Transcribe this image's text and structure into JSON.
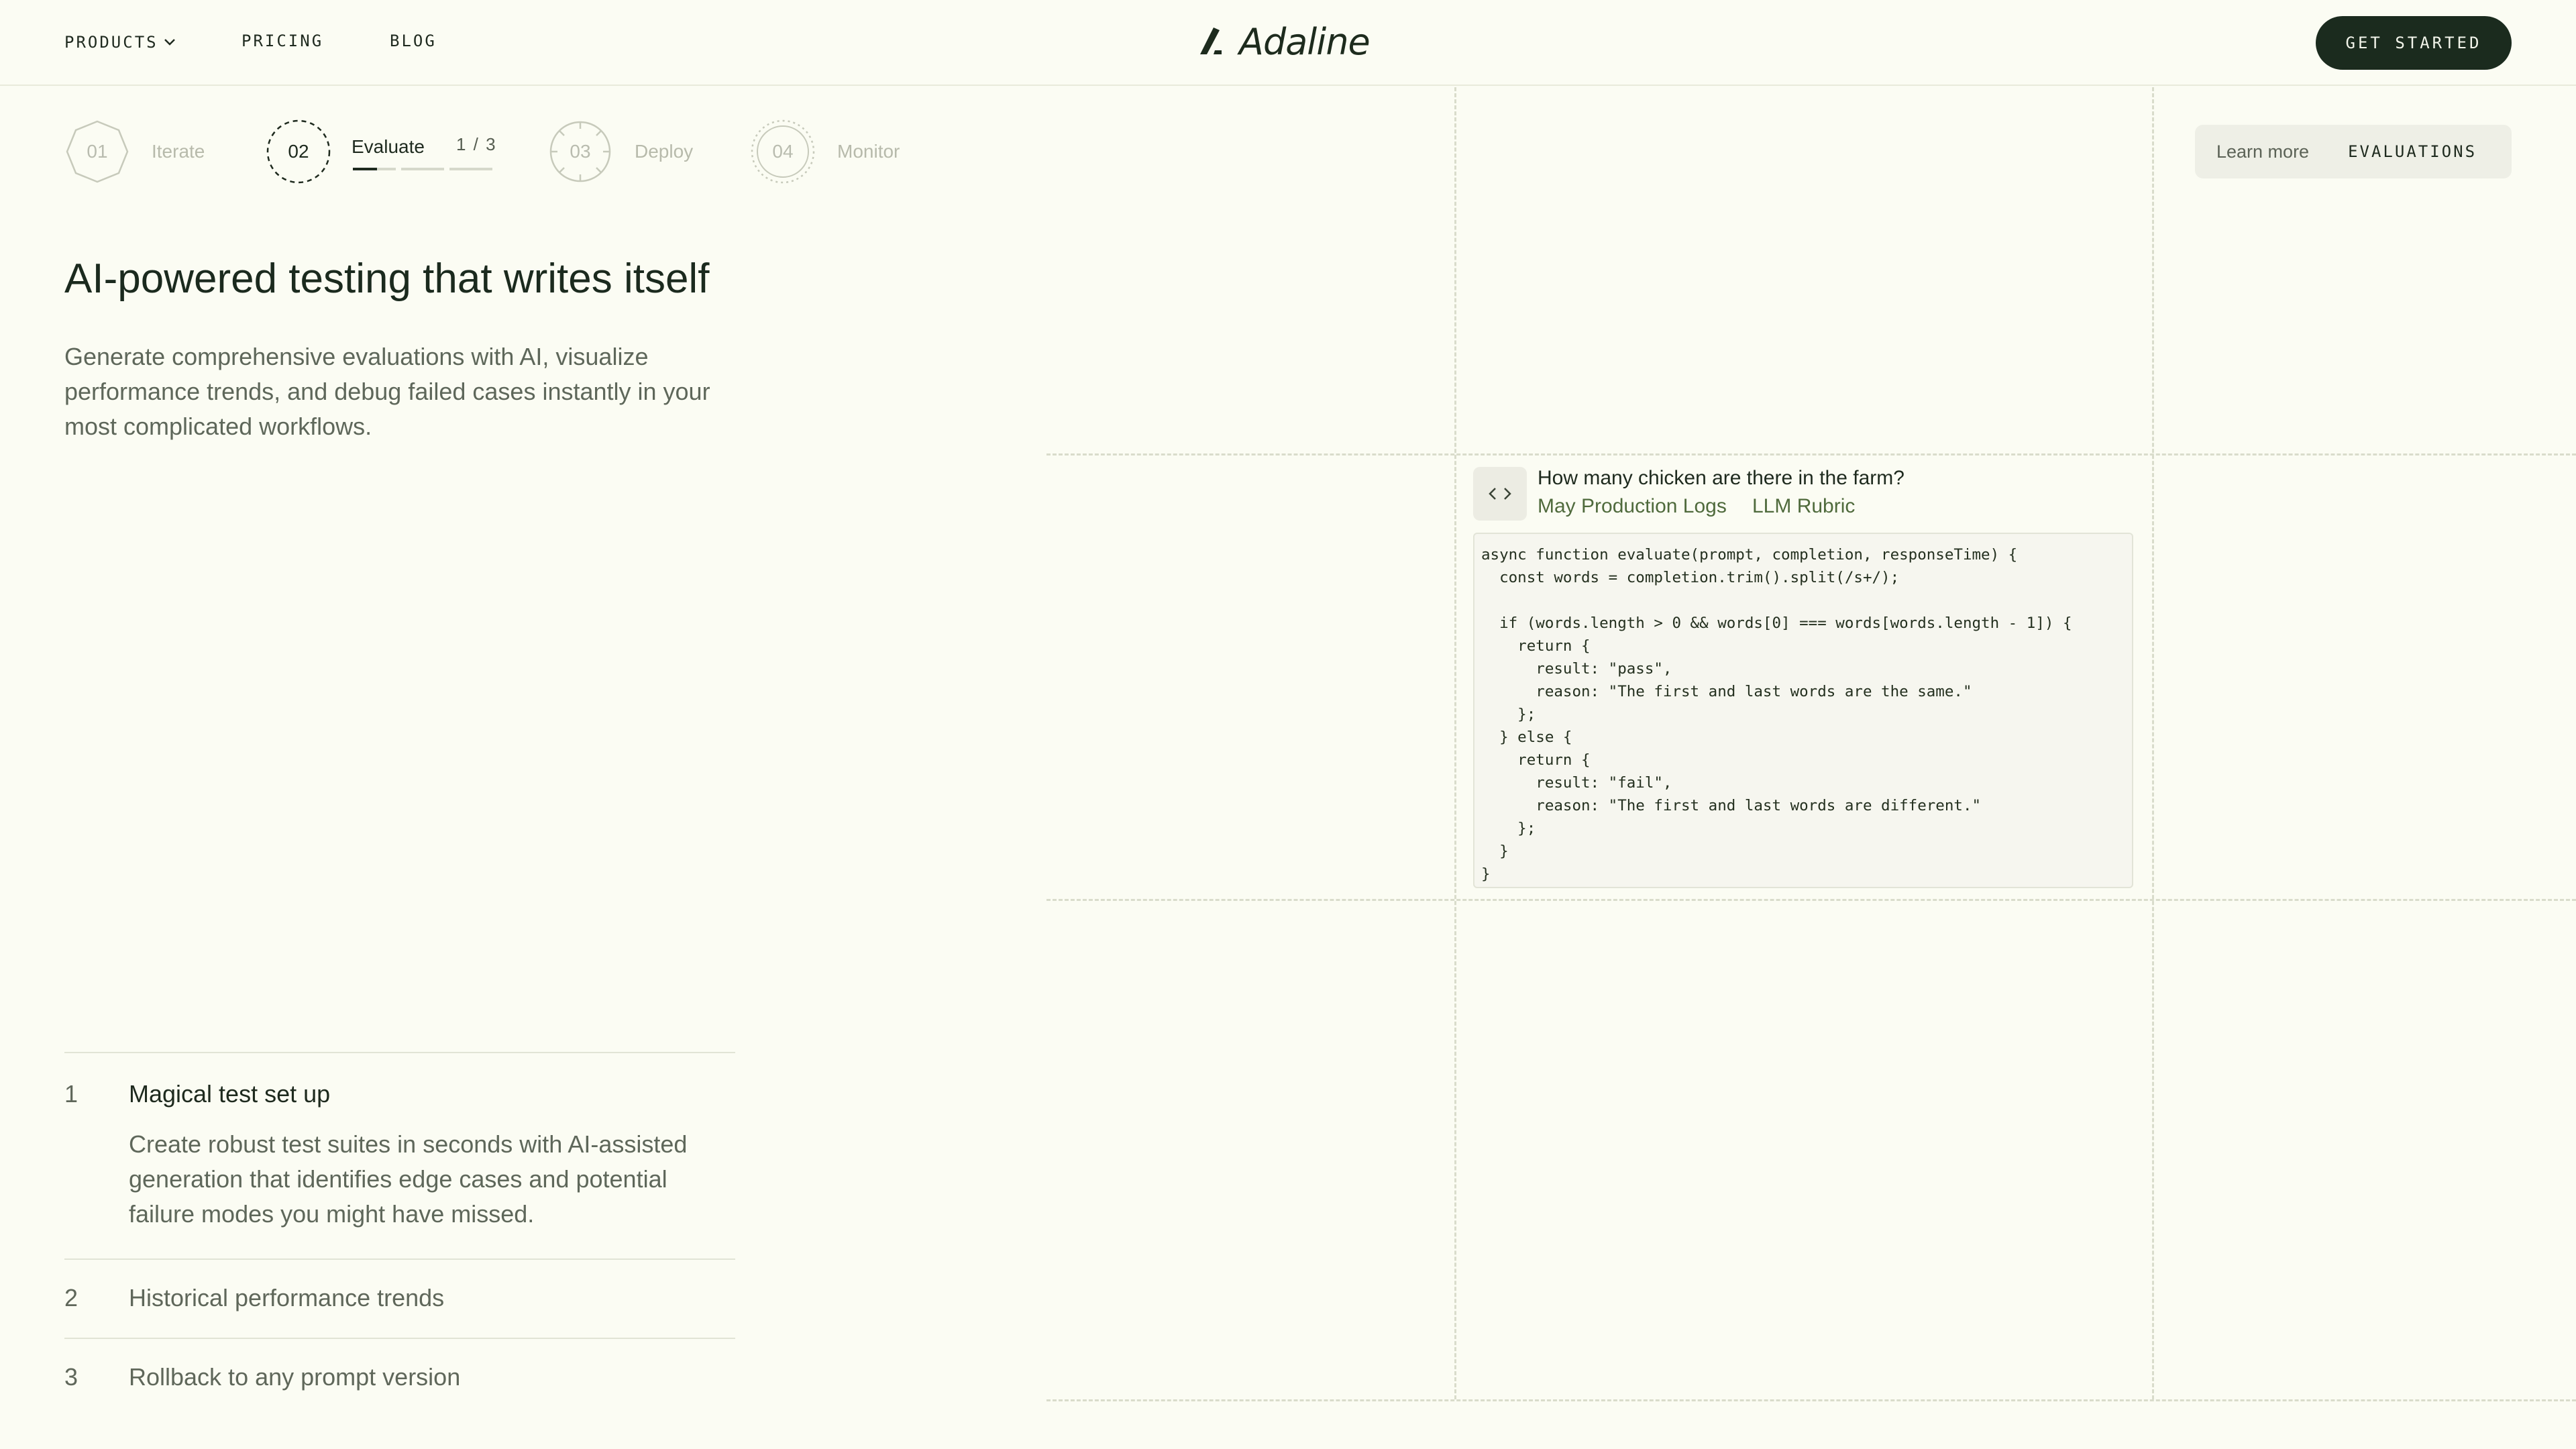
{
  "header": {
    "nav": [
      {
        "label": "PRODUCTS"
      },
      {
        "label": "PRICING"
      },
      {
        "label": "BLOG"
      }
    ],
    "logo_text": "Adaline",
    "cta_label": "GET STARTED"
  },
  "steps": {
    "items": [
      {
        "number": "01",
        "label": "Iterate"
      },
      {
        "number": "02",
        "label": "Evaluate"
      },
      {
        "number": "03",
        "label": "Deploy"
      },
      {
        "number": "04",
        "label": "Monitor"
      }
    ],
    "active_index": 1,
    "sub_counter": "1 / 3",
    "sub_progress": 1
  },
  "learn_more": {
    "link_label": "Learn more",
    "tag": "EVALUATIONS"
  },
  "hero": {
    "title": "AI-powered testing that writes itself",
    "description": "Generate comprehensive evaluations with AI, visualize performance trends, and debug failed cases instantly in your most complicated workflows."
  },
  "features": [
    {
      "number": "1",
      "title": "Magical test set up",
      "body": "Create robust test suites in seconds with AI-assisted generation that identifies edge cases and potential failure modes you might have missed."
    },
    {
      "number": "2",
      "title": "Historical performance trends"
    },
    {
      "number": "3",
      "title": "Rollback to any prompt version"
    }
  ],
  "card": {
    "question": "How many chicken are there in the farm?",
    "tags": [
      "May Production Logs",
      "LLM Rubric"
    ],
    "code": "async function evaluate(prompt, completion, responseTime) {\n  const words = completion.trim().split(/s+/);\n\n  if (words.length > 0 && words[0] === words[words.length - 1]) {\n    return {\n      result: \"pass\",\n      reason: \"The first and last words are the same.\"\n    };\n  } else {\n    return {\n      result: \"fail\",\n      reason: \"The first and last words are different.\"\n    };\n  }\n}"
  },
  "colors": {
    "background": "#fbfcf3",
    "primary_dark": "#1b2b1e",
    "muted_text": "#5e675a",
    "tag_green": "#4f6a3c"
  }
}
